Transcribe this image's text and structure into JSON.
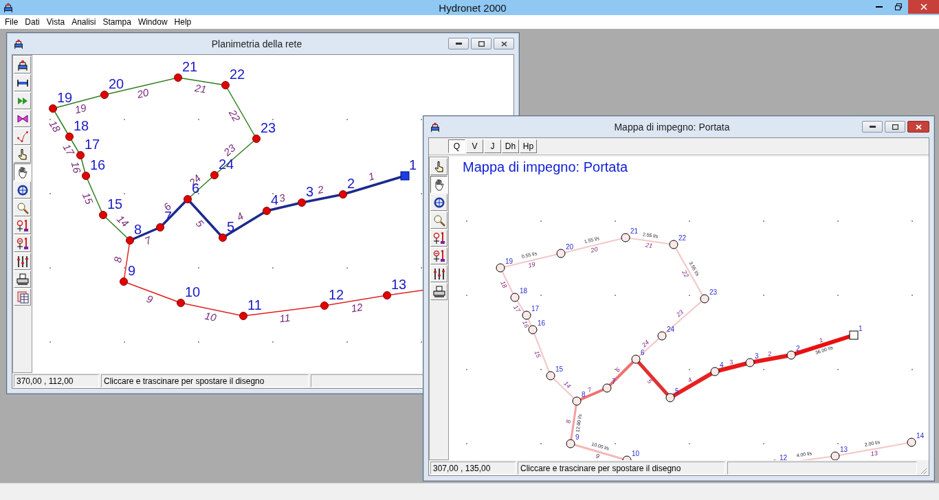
{
  "app": {
    "title": "Hydronet 2000"
  },
  "menu": [
    "File",
    "Dati",
    "Vista",
    "Analisi",
    "Stampa",
    "Window",
    "Help"
  ],
  "plan_window": {
    "title": "Planimetria della rete",
    "toolbar": [
      {
        "kind": "tank",
        "selected": false
      },
      {
        "kind": "pipe",
        "selected": false
      },
      {
        "kind": "pump",
        "selected": false
      },
      {
        "kind": "valve",
        "selected": false
      },
      {
        "kind": "polyline",
        "selected": false
      },
      {
        "kind": "pointer",
        "selected": false
      },
      {
        "kind": "hand",
        "selected": true
      },
      {
        "kind": "compass",
        "selected": false
      },
      {
        "kind": "zoom",
        "selected": false
      },
      {
        "kind": "zoom_in",
        "selected": false
      },
      {
        "kind": "zoom_out",
        "selected": false
      },
      {
        "kind": "sliders",
        "selected": false
      },
      {
        "kind": "print",
        "selected": false
      },
      {
        "kind": "table",
        "selected": false
      }
    ],
    "nodes": [
      {
        "label": "1",
        "kind": "reservoir"
      },
      {
        "label": "2",
        "kind": "junction"
      },
      {
        "label": "3",
        "kind": "junction"
      },
      {
        "label": "4",
        "kind": "junction"
      },
      {
        "label": "5",
        "kind": "junction"
      },
      {
        "label": "6",
        "kind": "junction"
      },
      {
        "label": "7",
        "kind": "junction"
      },
      {
        "label": "8",
        "kind": "junction"
      },
      {
        "label": "9",
        "kind": "junction"
      },
      {
        "label": "10",
        "kind": "junction"
      },
      {
        "label": "11",
        "kind": "junction"
      },
      {
        "label": "12",
        "kind": "junction"
      },
      {
        "label": "13",
        "kind": "junction"
      },
      {
        "label": "15",
        "kind": "junction"
      },
      {
        "label": "16",
        "kind": "junction"
      },
      {
        "label": "17",
        "kind": "junction"
      },
      {
        "label": "18",
        "kind": "junction"
      },
      {
        "label": "19",
        "kind": "junction"
      },
      {
        "label": "20",
        "kind": "junction"
      },
      {
        "label": "21",
        "kind": "junction"
      },
      {
        "label": "22",
        "kind": "junction"
      },
      {
        "label": "23",
        "kind": "junction"
      },
      {
        "label": "24",
        "kind": "junction"
      }
    ],
    "pipes": [
      {
        "label": "1",
        "color": "#1c2a8c",
        "kind": "main"
      },
      {
        "label": "2",
        "color": "#1c2a8c",
        "kind": "main"
      },
      {
        "label": "3",
        "color": "#1c2a8c",
        "kind": "main"
      },
      {
        "label": "4",
        "color": "#1c2a8c",
        "kind": "main"
      },
      {
        "label": "5",
        "color": "#1c2a8c",
        "kind": "main"
      },
      {
        "label": "6",
        "color": "#1c2a8c",
        "kind": "main"
      },
      {
        "label": "7",
        "color": "#1c2a8c",
        "kind": "main"
      },
      {
        "label": "8",
        "color": "#e02020",
        "kind": "branch"
      },
      {
        "label": "9",
        "color": "#e02020",
        "kind": "branch"
      },
      {
        "label": "10",
        "color": "#e02020",
        "kind": "branch"
      },
      {
        "label": "11",
        "color": "#e02020",
        "kind": "branch"
      },
      {
        "label": "12",
        "color": "#e02020",
        "kind": "branch"
      },
      {
        "color": "#e02020",
        "kind": "branch"
      },
      {
        "label": "14",
        "color": "#2e7d1e",
        "kind": "branch"
      },
      {
        "label": "15",
        "color": "#2e7d1e",
        "kind": "branch"
      },
      {
        "label": "16",
        "color": "#2e7d1e",
        "kind": "branch"
      },
      {
        "label": "17",
        "color": "#2e7d1e",
        "kind": "branch"
      },
      {
        "label": "18",
        "color": "#2e7d1e",
        "kind": "branch"
      },
      {
        "label": "19",
        "color": "#2e7d1e",
        "kind": "branch"
      },
      {
        "label": "20",
        "color": "#2e7d1e",
        "kind": "branch"
      },
      {
        "label": "21",
        "color": "#2e7d1e",
        "kind": "branch"
      },
      {
        "label": "22",
        "color": "#2e7d1e",
        "kind": "branch"
      },
      {
        "label": "23",
        "color": "#2e7d1e",
        "kind": "branch"
      },
      {
        "label": "24",
        "color": "#2e7d1e",
        "kind": "branch"
      }
    ],
    "status": {
      "coordinates": "370,00 , 112,00",
      "message": "Cliccare e trascinare per spostare il disegno"
    }
  },
  "map_window": {
    "title": "Mappa di impegno: Portata",
    "tabs": [
      {
        "label": "Q",
        "selected": true
      },
      {
        "label": "V",
        "selected": false
      },
      {
        "label": "J",
        "selected": false
      },
      {
        "label": "Dh",
        "selected": false
      },
      {
        "label": "Hp",
        "selected": false
      }
    ],
    "toolbar": [
      {
        "kind": "pointer",
        "selected": false
      },
      {
        "kind": "hand",
        "selected": true
      },
      {
        "kind": "compass",
        "selected": false
      },
      {
        "kind": "zoom",
        "selected": false
      },
      {
        "kind": "zoom_in",
        "selected": false
      },
      {
        "kind": "zoom_out",
        "selected": false
      },
      {
        "kind": "sliders",
        "selected": false
      },
      {
        "kind": "print",
        "selected": false
      }
    ],
    "heading": "Mappa di impegno: Portata",
    "nodes": [
      {
        "label": "1",
        "kind": "reservoir"
      },
      {
        "label": "2",
        "kind": "junction"
      },
      {
        "label": "3",
        "kind": "junction"
      },
      {
        "label": "4",
        "kind": "junction"
      },
      {
        "label": "5",
        "kind": "junction"
      },
      {
        "label": "6",
        "kind": "junction"
      },
      {
        "label": "7",
        "kind": "junction"
      },
      {
        "label": "8",
        "kind": "junction"
      },
      {
        "label": "9",
        "kind": "junction"
      },
      {
        "label": "10",
        "kind": "junction"
      },
      {
        "label": "12",
        "kind": "junction"
      },
      {
        "label": "13",
        "kind": "junction"
      },
      {
        "label": "14",
        "kind": "junction"
      },
      {
        "label": "15",
        "kind": "junction"
      },
      {
        "label": "16",
        "kind": "junction"
      },
      {
        "label": "17",
        "kind": "junction"
      },
      {
        "label": "18",
        "kind": "junction"
      },
      {
        "label": "19",
        "kind": "junction"
      },
      {
        "label": "20",
        "kind": "junction"
      },
      {
        "label": "21",
        "kind": "junction"
      },
      {
        "label": "22",
        "kind": "junction"
      },
      {
        "label": "23",
        "kind": "junction"
      },
      {
        "label": "24",
        "kind": "junction"
      }
    ],
    "pipes": [
      {
        "label": "1",
        "flow": "36.00 l/s",
        "color": "#e81010",
        "kind": "heavy"
      },
      {
        "label": "2",
        "color": "#e81818",
        "kind": "heavy"
      },
      {
        "label": "3",
        "color": "#e81818",
        "kind": "heavy"
      },
      {
        "label": "4",
        "color": "#e82020",
        "kind": "heavy"
      },
      {
        "label": "5",
        "color": "#e03030",
        "kind": "strong"
      },
      {
        "label": "6",
        "color": "#f07070",
        "kind": "medium"
      },
      {
        "label": "7",
        "color": "#f07070",
        "kind": "medium"
      },
      {
        "label": "8",
        "flow": "12.00 l/s",
        "color": "#f0a0a0",
        "kind": "light"
      },
      {
        "label": "9",
        "flow": "10.00 l/s",
        "color": "#f4b8b8",
        "kind": "light"
      },
      {
        "flow": "4.00 l/s",
        "color": "#f5c8c8",
        "kind": "faint"
      },
      {
        "label": "13",
        "flow": "2.00 l/s",
        "color": "#f5c8c8",
        "kind": "faint"
      },
      {
        "label": "14",
        "color": "#f5c8c8",
        "kind": "faint"
      },
      {
        "label": "15",
        "color": "#f5c8c8",
        "kind": "faint"
      },
      {
        "label": "16",
        "color": "#f5c8c8",
        "kind": "faint"
      },
      {
        "label": "17",
        "color": "#f5c8c8",
        "kind": "faint"
      },
      {
        "label": "18",
        "color": "#f5c8c8",
        "kind": "faint"
      },
      {
        "label": "19",
        "flow": "0.55 l/s",
        "color": "#f5c8c8",
        "kind": "faint"
      },
      {
        "label": "20",
        "flow": "1.55 l/s",
        "color": "#f5c8c8",
        "kind": "faint"
      },
      {
        "label": "21",
        "flow": "2.55 l/s",
        "color": "#f5c8c8",
        "kind": "faint"
      },
      {
        "label": "22",
        "flow": "3.55 l/s",
        "color": "#f5c8c8",
        "kind": "faint"
      },
      {
        "label": "23",
        "color": "#f5c8c8",
        "kind": "faint"
      },
      {
        "label": "24",
        "color": "#f5c8c8",
        "kind": "faint"
      }
    ],
    "status": {
      "coordinates": "307,00 , 135,00",
      "message": "Cliccare e trascinare per spostare il disegno"
    }
  }
}
